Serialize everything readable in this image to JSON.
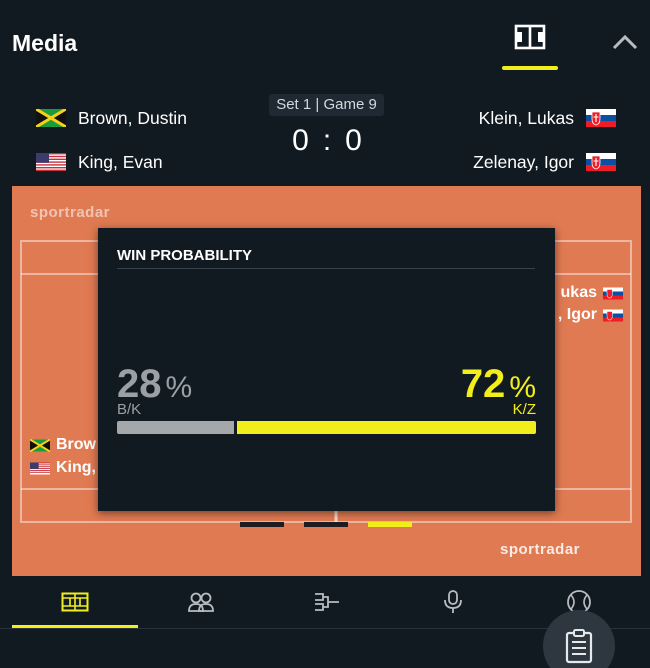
{
  "header": {
    "title": "Media",
    "court_icon": "court-view-icon",
    "collapse_icon": "chevron-up-icon"
  },
  "match": {
    "status": "Set 1 | Game 9",
    "score_left": "0",
    "score_sep": ":",
    "score_right": "0",
    "team_left": {
      "players": [
        {
          "name": "Brown, Dustin",
          "flag": "jamaica-flag"
        },
        {
          "name": "King, Evan",
          "flag": "usa-flag"
        }
      ]
    },
    "team_right": {
      "players": [
        {
          "name": "Klein, Lukas",
          "flag": "slovakia-flag"
        },
        {
          "name": "Zelenay, Igor",
          "flag": "slovakia-flag"
        }
      ]
    }
  },
  "court": {
    "logo_text_top": "sportradar",
    "logo_text_bottom": "sportradar",
    "background_players_right": [
      "ukas",
      ", Igor"
    ],
    "background_players_left": [
      "Brow",
      "King,"
    ],
    "pager_active_index": 2
  },
  "win_probability": {
    "title": "WIN PROBABILITY",
    "left_value": "28",
    "right_value": "72",
    "percent_symbol": "%",
    "left_label": "B/K",
    "right_label": "K/Z",
    "left_fraction": 0.28
  },
  "tabs": [
    {
      "name": "court",
      "icon": "court-icon",
      "active": true
    },
    {
      "name": "lineups",
      "icon": "players-icon",
      "active": false
    },
    {
      "name": "bracket",
      "icon": "bracket-icon",
      "active": false
    },
    {
      "name": "commentary",
      "icon": "microphone-icon",
      "active": false
    },
    {
      "name": "stats",
      "icon": "tennis-ball-icon",
      "active": false
    }
  ],
  "fab": {
    "icon": "clipboard-icon"
  },
  "colors": {
    "background": "#121a21",
    "court": "#e07a52",
    "accent": "#f2ee1c",
    "muted": "#9aa0a5"
  }
}
